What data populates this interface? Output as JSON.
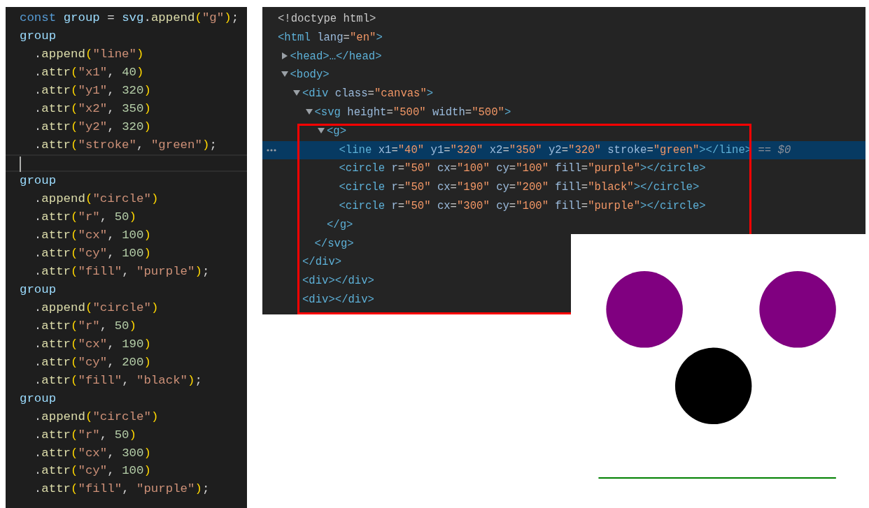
{
  "editor": {
    "lines": [
      {
        "current": false,
        "tokens": [
          {
            "kind": "keyword",
            "text": "const "
          },
          {
            "kind": "variable",
            "text": "group"
          },
          {
            "kind": "plain",
            "text": " = "
          },
          {
            "kind": "variable",
            "text": "svg"
          },
          {
            "kind": "plain",
            "text": "."
          },
          {
            "kind": "function",
            "text": "append"
          },
          {
            "kind": "bracket",
            "text": "("
          },
          {
            "kind": "string",
            "text": "\"g\""
          },
          {
            "kind": "bracket",
            "text": ")"
          },
          {
            "kind": "plain",
            "text": ";"
          }
        ]
      },
      {
        "current": false,
        "tokens": [
          {
            "kind": "variable",
            "text": "group"
          }
        ]
      },
      {
        "current": false,
        "tokens": [
          {
            "kind": "plain",
            "text": "  ."
          },
          {
            "kind": "function",
            "text": "append"
          },
          {
            "kind": "bracket",
            "text": "("
          },
          {
            "kind": "string",
            "text": "\"line\""
          },
          {
            "kind": "bracket",
            "text": ")"
          }
        ]
      },
      {
        "current": false,
        "tokens": [
          {
            "kind": "plain",
            "text": "  ."
          },
          {
            "kind": "function",
            "text": "attr"
          },
          {
            "kind": "bracket",
            "text": "("
          },
          {
            "kind": "string",
            "text": "\"x1\""
          },
          {
            "kind": "plain",
            "text": ", "
          },
          {
            "kind": "number",
            "text": "40"
          },
          {
            "kind": "bracket",
            "text": ")"
          }
        ]
      },
      {
        "current": false,
        "tokens": [
          {
            "kind": "plain",
            "text": "  ."
          },
          {
            "kind": "function",
            "text": "attr"
          },
          {
            "kind": "bracket",
            "text": "("
          },
          {
            "kind": "string",
            "text": "\"y1\""
          },
          {
            "kind": "plain",
            "text": ", "
          },
          {
            "kind": "number",
            "text": "320"
          },
          {
            "kind": "bracket",
            "text": ")"
          }
        ]
      },
      {
        "current": false,
        "tokens": [
          {
            "kind": "plain",
            "text": "  ."
          },
          {
            "kind": "function",
            "text": "attr"
          },
          {
            "kind": "bracket",
            "text": "("
          },
          {
            "kind": "string",
            "text": "\"x2\""
          },
          {
            "kind": "plain",
            "text": ", "
          },
          {
            "kind": "number",
            "text": "350"
          },
          {
            "kind": "bracket",
            "text": ")"
          }
        ]
      },
      {
        "current": false,
        "tokens": [
          {
            "kind": "plain",
            "text": "  ."
          },
          {
            "kind": "function",
            "text": "attr"
          },
          {
            "kind": "bracket",
            "text": "("
          },
          {
            "kind": "string",
            "text": "\"y2\""
          },
          {
            "kind": "plain",
            "text": ", "
          },
          {
            "kind": "number",
            "text": "320"
          },
          {
            "kind": "bracket",
            "text": ")"
          }
        ]
      },
      {
        "current": false,
        "tokens": [
          {
            "kind": "plain",
            "text": "  ."
          },
          {
            "kind": "function",
            "text": "attr"
          },
          {
            "kind": "bracket",
            "text": "("
          },
          {
            "kind": "string",
            "text": "\"stroke\""
          },
          {
            "kind": "plain",
            "text": ", "
          },
          {
            "kind": "string",
            "text": "\"green\""
          },
          {
            "kind": "bracket",
            "text": ")"
          },
          {
            "kind": "plain",
            "text": ";"
          }
        ]
      },
      {
        "current": true
      },
      {
        "current": false,
        "tokens": [
          {
            "kind": "variable",
            "text": "group"
          }
        ]
      },
      {
        "current": false,
        "tokens": [
          {
            "kind": "plain",
            "text": "  ."
          },
          {
            "kind": "function",
            "text": "append"
          },
          {
            "kind": "bracket",
            "text": "("
          },
          {
            "kind": "string",
            "text": "\"circle\""
          },
          {
            "kind": "bracket",
            "text": ")"
          }
        ]
      },
      {
        "current": false,
        "tokens": [
          {
            "kind": "plain",
            "text": "  ."
          },
          {
            "kind": "function",
            "text": "attr"
          },
          {
            "kind": "bracket",
            "text": "("
          },
          {
            "kind": "string",
            "text": "\"r\""
          },
          {
            "kind": "plain",
            "text": ", "
          },
          {
            "kind": "number",
            "text": "50"
          },
          {
            "kind": "bracket",
            "text": ")"
          }
        ]
      },
      {
        "current": false,
        "tokens": [
          {
            "kind": "plain",
            "text": "  ."
          },
          {
            "kind": "function",
            "text": "attr"
          },
          {
            "kind": "bracket",
            "text": "("
          },
          {
            "kind": "string",
            "text": "\"cx\""
          },
          {
            "kind": "plain",
            "text": ", "
          },
          {
            "kind": "number",
            "text": "100"
          },
          {
            "kind": "bracket",
            "text": ")"
          }
        ]
      },
      {
        "current": false,
        "tokens": [
          {
            "kind": "plain",
            "text": "  ."
          },
          {
            "kind": "function",
            "text": "attr"
          },
          {
            "kind": "bracket",
            "text": "("
          },
          {
            "kind": "string",
            "text": "\"cy\""
          },
          {
            "kind": "plain",
            "text": ", "
          },
          {
            "kind": "number",
            "text": "100"
          },
          {
            "kind": "bracket",
            "text": ")"
          }
        ]
      },
      {
        "current": false,
        "tokens": [
          {
            "kind": "plain",
            "text": "  ."
          },
          {
            "kind": "function",
            "text": "attr"
          },
          {
            "kind": "bracket",
            "text": "("
          },
          {
            "kind": "string",
            "text": "\"fill\""
          },
          {
            "kind": "plain",
            "text": ", "
          },
          {
            "kind": "string",
            "text": "\"purple\""
          },
          {
            "kind": "bracket",
            "text": ")"
          },
          {
            "kind": "plain",
            "text": ";"
          }
        ]
      },
      {
        "current": false,
        "tokens": [
          {
            "kind": "variable",
            "text": "group"
          }
        ]
      },
      {
        "current": false,
        "tokens": [
          {
            "kind": "plain",
            "text": "  ."
          },
          {
            "kind": "function",
            "text": "append"
          },
          {
            "kind": "bracket",
            "text": "("
          },
          {
            "kind": "string",
            "text": "\"circle\""
          },
          {
            "kind": "bracket",
            "text": ")"
          }
        ]
      },
      {
        "current": false,
        "tokens": [
          {
            "kind": "plain",
            "text": "  ."
          },
          {
            "kind": "function",
            "text": "attr"
          },
          {
            "kind": "bracket",
            "text": "("
          },
          {
            "kind": "string",
            "text": "\"r\""
          },
          {
            "kind": "plain",
            "text": ", "
          },
          {
            "kind": "number",
            "text": "50"
          },
          {
            "kind": "bracket",
            "text": ")"
          }
        ]
      },
      {
        "current": false,
        "tokens": [
          {
            "kind": "plain",
            "text": "  ."
          },
          {
            "kind": "function",
            "text": "attr"
          },
          {
            "kind": "bracket",
            "text": "("
          },
          {
            "kind": "string",
            "text": "\"cx\""
          },
          {
            "kind": "plain",
            "text": ", "
          },
          {
            "kind": "number",
            "text": "190"
          },
          {
            "kind": "bracket",
            "text": ")"
          }
        ]
      },
      {
        "current": false,
        "tokens": [
          {
            "kind": "plain",
            "text": "  ."
          },
          {
            "kind": "function",
            "text": "attr"
          },
          {
            "kind": "bracket",
            "text": "("
          },
          {
            "kind": "string",
            "text": "\"cy\""
          },
          {
            "kind": "plain",
            "text": ", "
          },
          {
            "kind": "number",
            "text": "200"
          },
          {
            "kind": "bracket",
            "text": ")"
          }
        ]
      },
      {
        "current": false,
        "tokens": [
          {
            "kind": "plain",
            "text": "  ."
          },
          {
            "kind": "function",
            "text": "attr"
          },
          {
            "kind": "bracket",
            "text": "("
          },
          {
            "kind": "string",
            "text": "\"fill\""
          },
          {
            "kind": "plain",
            "text": ", "
          },
          {
            "kind": "string",
            "text": "\"black\""
          },
          {
            "kind": "bracket",
            "text": ")"
          },
          {
            "kind": "plain",
            "text": ";"
          }
        ]
      },
      {
        "current": false,
        "tokens": [
          {
            "kind": "variable",
            "text": "group"
          }
        ]
      },
      {
        "current": false,
        "tokens": [
          {
            "kind": "plain",
            "text": "  ."
          },
          {
            "kind": "function",
            "text": "append"
          },
          {
            "kind": "bracket",
            "text": "("
          },
          {
            "kind": "string",
            "text": "\"circle\""
          },
          {
            "kind": "bracket",
            "text": ")"
          }
        ]
      },
      {
        "current": false,
        "tokens": [
          {
            "kind": "plain",
            "text": "  ."
          },
          {
            "kind": "function",
            "text": "attr"
          },
          {
            "kind": "bracket",
            "text": "("
          },
          {
            "kind": "string",
            "text": "\"r\""
          },
          {
            "kind": "plain",
            "text": ", "
          },
          {
            "kind": "number",
            "text": "50"
          },
          {
            "kind": "bracket",
            "text": ")"
          }
        ]
      },
      {
        "current": false,
        "tokens": [
          {
            "kind": "plain",
            "text": "  ."
          },
          {
            "kind": "function",
            "text": "attr"
          },
          {
            "kind": "bracket",
            "text": "("
          },
          {
            "kind": "string",
            "text": "\"cx\""
          },
          {
            "kind": "plain",
            "text": ", "
          },
          {
            "kind": "number",
            "text": "300"
          },
          {
            "kind": "bracket",
            "text": ")"
          }
        ]
      },
      {
        "current": false,
        "tokens": [
          {
            "kind": "plain",
            "text": "  ."
          },
          {
            "kind": "function",
            "text": "attr"
          },
          {
            "kind": "bracket",
            "text": "("
          },
          {
            "kind": "string",
            "text": "\"cy\""
          },
          {
            "kind": "plain",
            "text": ", "
          },
          {
            "kind": "number",
            "text": "100"
          },
          {
            "kind": "bracket",
            "text": ")"
          }
        ]
      },
      {
        "current": false,
        "tokens": [
          {
            "kind": "plain",
            "text": "  ."
          },
          {
            "kind": "function",
            "text": "attr"
          },
          {
            "kind": "bracket",
            "text": "("
          },
          {
            "kind": "string",
            "text": "\"fill\""
          },
          {
            "kind": "plain",
            "text": ", "
          },
          {
            "kind": "string",
            "text": "\"purple\""
          },
          {
            "kind": "bracket",
            "text": ")"
          },
          {
            "kind": "plain",
            "text": ";"
          }
        ]
      }
    ]
  },
  "elements_panel": {
    "nodes": [
      {
        "selected": false,
        "open": [
          {
            "kind": "doctype",
            "text": "<!doctype html>"
          }
        ]
      },
      {
        "selected": false,
        "open": [
          {
            "kind": "tag",
            "text": "<html"
          },
          {
            "kind": "attr",
            "text": "lang"
          },
          {
            "kind": "plain",
            "text": "="
          },
          {
            "kind": "value",
            "text": "\"en\""
          },
          {
            "kind": "tag",
            "text": ">"
          }
        ],
        "children": [
          {
            "selected": false,
            "expanded": false,
            "open": [
              {
                "kind": "tag",
                "text": "<head>…</head>"
              }
            ]
          },
          {
            "selected": false,
            "expanded": true,
            "open": [
              {
                "kind": "tag",
                "text": "<body>"
              }
            ],
            "children": [
              {
                "selected": false,
                "expanded": true,
                "open": [
                  {
                    "kind": "tag",
                    "text": "<div"
                  },
                  {
                    "kind": "attr",
                    "text": "class"
                  },
                  {
                    "kind": "plain",
                    "text": "="
                  },
                  {
                    "kind": "value",
                    "text": "\"canvas\""
                  },
                  {
                    "kind": "tag",
                    "text": ">"
                  }
                ],
                "close": [
                  {
                    "kind": "tag",
                    "text": "</div>"
                  }
                ],
                "children": [
                  {
                    "selected": false,
                    "expanded": true,
                    "open": [
                      {
                        "kind": "tag",
                        "text": "<svg"
                      },
                      {
                        "kind": "attr",
                        "text": "height"
                      },
                      {
                        "kind": "plain",
                        "text": "="
                      },
                      {
                        "kind": "value",
                        "text": "\"500\""
                      },
                      {
                        "kind": "attr",
                        "text": "width"
                      },
                      {
                        "kind": "plain",
                        "text": "="
                      },
                      {
                        "kind": "value",
                        "text": "\"500\""
                      },
                      {
                        "kind": "tag",
                        "text": ">"
                      }
                    ],
                    "close": [
                      {
                        "kind": "tag",
                        "text": "</svg>"
                      }
                    ],
                    "children": [
                      {
                        "selected": false,
                        "expanded": true,
                        "open": [
                          {
                            "kind": "tag",
                            "text": "<g>"
                          }
                        ],
                        "close": [
                          {
                            "kind": "tag",
                            "text": "</g>"
                          }
                        ],
                        "children": [
                          {
                            "selected": true,
                            "open": [
                              {
                                "kind": "tag",
                                "text": "<line"
                              },
                              {
                                "kind": "attr",
                                "text": "x1"
                              },
                              {
                                "kind": "plain",
                                "text": "="
                              },
                              {
                                "kind": "value",
                                "text": "\"40\""
                              },
                              {
                                "kind": "attr",
                                "text": "y1"
                              },
                              {
                                "kind": "plain",
                                "text": "="
                              },
                              {
                                "kind": "value",
                                "text": "\"320\""
                              },
                              {
                                "kind": "attr",
                                "text": "x2"
                              },
                              {
                                "kind": "plain",
                                "text": "="
                              },
                              {
                                "kind": "value",
                                "text": "\"350\""
                              },
                              {
                                "kind": "attr",
                                "text": "y2"
                              },
                              {
                                "kind": "plain",
                                "text": "="
                              },
                              {
                                "kind": "value",
                                "text": "\"320\""
                              },
                              {
                                "kind": "attr",
                                "text": "stroke"
                              },
                              {
                                "kind": "plain",
                                "text": "="
                              },
                              {
                                "kind": "value",
                                "text": "\"green\""
                              },
                              {
                                "kind": "tag",
                                "text": "></line>"
                              },
                              {
                                "kind": "hint",
                                "text": " == $0"
                              }
                            ]
                          },
                          {
                            "selected": false,
                            "open": [
                              {
                                "kind": "tag",
                                "text": "<circle"
                              },
                              {
                                "kind": "attr",
                                "text": "r"
                              },
                              {
                                "kind": "plain",
                                "text": "="
                              },
                              {
                                "kind": "value",
                                "text": "\"50\""
                              },
                              {
                                "kind": "attr",
                                "text": "cx"
                              },
                              {
                                "kind": "plain",
                                "text": "="
                              },
                              {
                                "kind": "value",
                                "text": "\"100\""
                              },
                              {
                                "kind": "attr",
                                "text": "cy"
                              },
                              {
                                "kind": "plain",
                                "text": "="
                              },
                              {
                                "kind": "value",
                                "text": "\"100\""
                              },
                              {
                                "kind": "attr",
                                "text": "fill"
                              },
                              {
                                "kind": "plain",
                                "text": "="
                              },
                              {
                                "kind": "value",
                                "text": "\"purple\""
                              },
                              {
                                "kind": "tag",
                                "text": "></circle>"
                              }
                            ]
                          },
                          {
                            "selected": false,
                            "open": [
                              {
                                "kind": "tag",
                                "text": "<circle"
                              },
                              {
                                "kind": "attr",
                                "text": "r"
                              },
                              {
                                "kind": "plain",
                                "text": "="
                              },
                              {
                                "kind": "value",
                                "text": "\"50\""
                              },
                              {
                                "kind": "attr",
                                "text": "cx"
                              },
                              {
                                "kind": "plain",
                                "text": "="
                              },
                              {
                                "kind": "value",
                                "text": "\"190\""
                              },
                              {
                                "kind": "attr",
                                "text": "cy"
                              },
                              {
                                "kind": "plain",
                                "text": "="
                              },
                              {
                                "kind": "value",
                                "text": "\"200\""
                              },
                              {
                                "kind": "attr",
                                "text": "fill"
                              },
                              {
                                "kind": "plain",
                                "text": "="
                              },
                              {
                                "kind": "value",
                                "text": "\"black\""
                              },
                              {
                                "kind": "tag",
                                "text": "></circle>"
                              }
                            ]
                          },
                          {
                            "selected": false,
                            "open": [
                              {
                                "kind": "tag",
                                "text": "<circle"
                              },
                              {
                                "kind": "attr",
                                "text": "r"
                              },
                              {
                                "kind": "plain",
                                "text": "="
                              },
                              {
                                "kind": "value",
                                "text": "\"50\""
                              },
                              {
                                "kind": "attr",
                                "text": "cx"
                              },
                              {
                                "kind": "plain",
                                "text": "="
                              },
                              {
                                "kind": "value",
                                "text": "\"300\""
                              },
                              {
                                "kind": "attr",
                                "text": "cy"
                              },
                              {
                                "kind": "plain",
                                "text": "="
                              },
                              {
                                "kind": "value",
                                "text": "\"100\""
                              },
                              {
                                "kind": "attr",
                                "text": "fill"
                              },
                              {
                                "kind": "plain",
                                "text": "="
                              },
                              {
                                "kind": "value",
                                "text": "\"purple\""
                              },
                              {
                                "kind": "tag",
                                "text": "></circle>"
                              }
                            ]
                          }
                        ]
                      }
                    ]
                  }
                ]
              },
              {
                "selected": false,
                "open": [
                  {
                    "kind": "tag",
                    "text": "<div></div>"
                  }
                ]
              },
              {
                "selected": false,
                "open": [
                  {
                    "kind": "tag",
                    "text": "<div></div>"
                  }
                ]
              }
            ]
          }
        ]
      }
    ]
  },
  "render": {
    "shapes": [
      {
        "kind": "line",
        "color": "#008000"
      },
      {
        "kind": "circle",
        "color": "#800080"
      },
      {
        "kind": "circle",
        "color": "#000000"
      },
      {
        "kind": "circle",
        "color": "#800080"
      }
    ]
  }
}
